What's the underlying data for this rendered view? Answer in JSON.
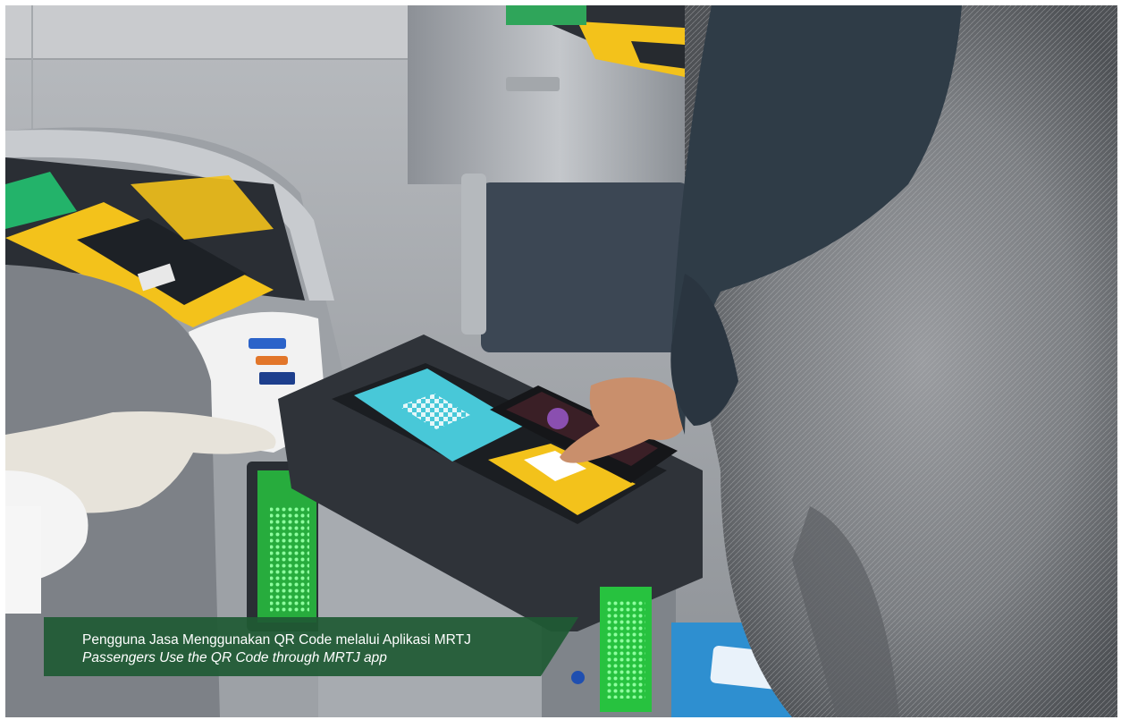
{
  "photo": {
    "subject": "photo-passenger-scanning-qr-code-at-mrt-gate"
  },
  "caption": {
    "indonesian": "Pengguna Jasa Menggunakan QR Code melalui Aplikasi MRTJ",
    "english": "Passengers Use the QR Code through MRTJ app"
  },
  "colors": {
    "caption_background": "#1f5a34",
    "caption_dot": "#1f4fb0",
    "gate_yellow": "#f3c21b",
    "indicator_green": "#39e05a",
    "screen_cyan": "#48c8d8"
  }
}
